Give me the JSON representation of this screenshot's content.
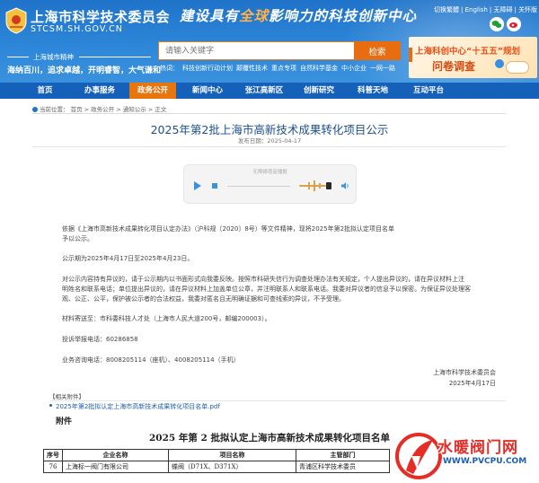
{
  "header": {
    "site_name": "上海市科学技术委员会",
    "site_url": "STCSM.SH.GOV.CN",
    "spirit_label": "上海城市精神",
    "spirit_text": "海纳百川，追求卓越，开明睿智，大气谦和",
    "slogan_part1": "建设具有",
    "slogan_accent": "全球",
    "slogan_part2": "影响力的科技创新中心",
    "top_links": [
      "切换繁體",
      "English",
      "无障碍",
      "关怀版"
    ],
    "search_placeholder": "请输入关键字",
    "search_button": "检索",
    "hot_label": "热词：",
    "hot_words": [
      "科技创新行动计划",
      "颠覆性技术",
      "重点专项",
      "自然科学基金",
      "中小企业",
      "一网一路"
    ],
    "banner_line1": "上海科创中心“十五五”规划",
    "banner_line2": "问卷调查",
    "colors": {
      "header_blue": "#2d86d8",
      "nav_blue": "#1560b8",
      "accent_orange": "#e8760f"
    }
  },
  "nav": {
    "items": [
      "首页",
      "办事服务",
      "政务公开",
      "新闻中心",
      "张江高新区",
      "创新研究",
      "科普天地",
      "互动平台"
    ],
    "active_index": 2
  },
  "breadcrumb": {
    "label": "当前位置：",
    "items": [
      "首页",
      "政务公开",
      "通知公示",
      "正文"
    ]
  },
  "article": {
    "title": "2025年第2批上海市高新技术成果转化项目公示",
    "publish_date": "发布日期：2025-04-17",
    "audio_label": "无障碍语音播报",
    "paragraphs": [
      "依据《上海市高新技术成果转化项目认定办法》（沪科规〔2020〕8号）等文件精神，现将2025年第2批拟认定项目名单",
      "予以公示。",
      "公示期为2025年4月17日至2025年4月23日。",
      "对公示内容持有异议的，请于公示期内以书面形式向我委反映。按照市科研失信行为调查处理办法有关规定，个人提出异议的，请在异议材料上注",
      "明姓名和联系电话；单位提出异议的，请在异议材料上加盖单位公章，并注明联系人和联系电话。我委对异议者的信息予以保密。为保证异议处理客",
      "观、公正、公平，保护被公示者的合法权益，我委对匿名且无明确证据和可查线索的异议，不予受理。",
      "材料寄送至：市科委科技人才处（上海市人民大道200号，邮编200003）。",
      "投诉举报电话：60286858",
      "业务咨询电话：8008205114（座机）、4008205114（手机）"
    ],
    "signature_org": "上海市科学技术委员会",
    "signature_date": "2025年4月17日"
  },
  "attachments": {
    "label": "【相关附件】",
    "items": [
      "2025年第2批拟认定上海市高新技术成果转化项目名单.pdf"
    ]
  },
  "appendix": {
    "label": "附件",
    "list_title": "2025 年第 2 批拟认定上海市高新技术成果转化项目名单",
    "table": {
      "headers": [
        "序号",
        "企业名称",
        "项目名称",
        "主管部门"
      ],
      "rows": [
        [
          "76",
          "上海标一阀门有限公司",
          "蝶阀（D71X、D371X）",
          "青浦区科学技术委员"
        ]
      ]
    }
  },
  "watermark": {
    "name": "水暖阀门网",
    "url": "WWW.PVCPU.COM"
  }
}
